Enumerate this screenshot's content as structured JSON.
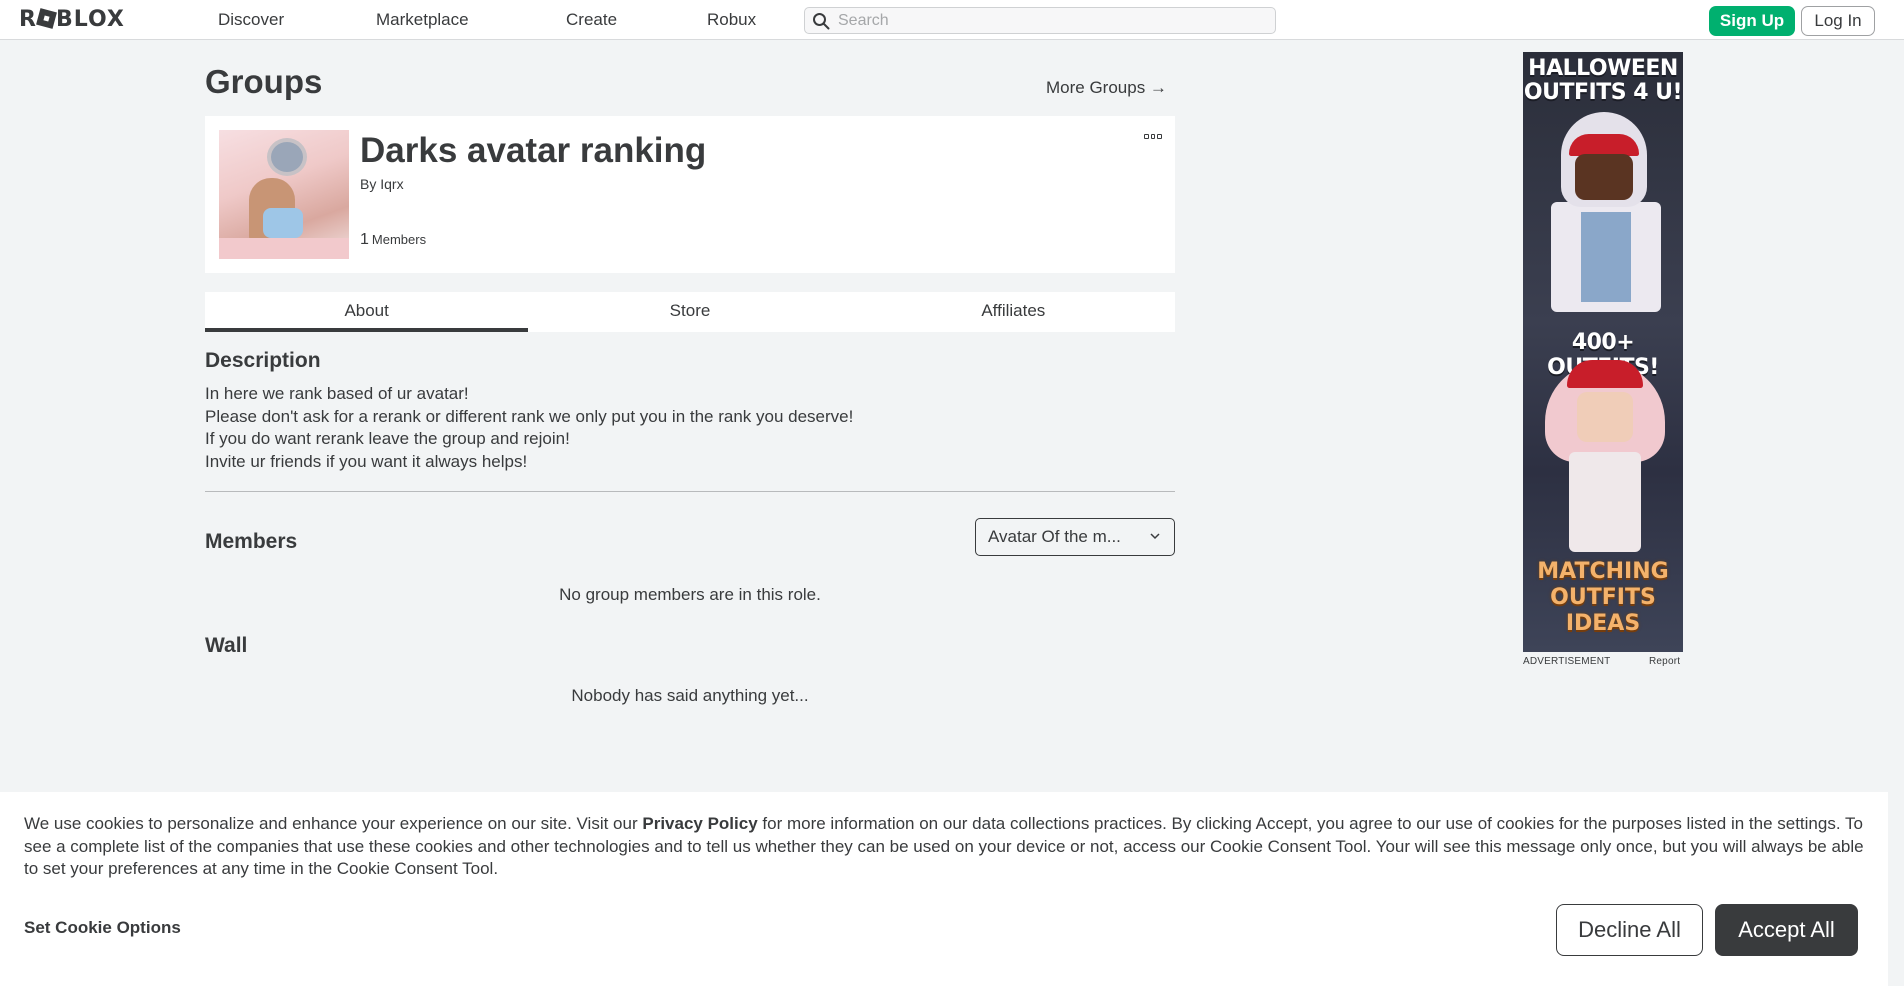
{
  "nav": {
    "logo": "ROBLOX",
    "links": [
      "Discover",
      "Marketplace",
      "Create",
      "Robux"
    ],
    "search_placeholder": "Search",
    "signup_label": "Sign Up",
    "login_label": "Log In"
  },
  "page": {
    "title": "Groups",
    "more_groups": "More Groups →"
  },
  "group": {
    "name": "Darks avatar ranking",
    "by_prefix": "By",
    "owner": "Iqrx",
    "member_count": "1",
    "member_label": "Members"
  },
  "tabs": [
    {
      "label": "About",
      "active": true
    },
    {
      "label": "Store",
      "active": false
    },
    {
      "label": "Affiliates",
      "active": false
    }
  ],
  "about": {
    "description_title": "Description",
    "description_lines": [
      "In here we rank based of ur avatar!",
      "Please don't ask for a rerank or different rank we only put you in the rank you deserve!",
      "If you do want rerank leave the group and rejoin!",
      "Invite ur friends if you want it always helps!"
    ],
    "members_title": "Members",
    "role_selected": "Avatar Of the m...",
    "members_empty": "No group members are in this role.",
    "wall_title": "Wall",
    "wall_empty": "Nobody has said anything yet..."
  },
  "ad": {
    "headline_1": "HALLOWEEN",
    "headline_2": "OUTFITS 4 U!",
    "middle": "400+ OUTFITS!",
    "logo_1": "MATCHING",
    "logo_2": "OUTFITS",
    "logo_3": "IDEAS",
    "label": "ADVERTISEMENT",
    "report": "Report"
  },
  "cookie": {
    "text_before": "We use cookies to personalize and enhance your experience on our site. Visit our ",
    "privacy_link": "Privacy Policy",
    "text_after": " for more information on our data collections practices. By clicking Accept, you agree to our use of cookies for the purposes listed in the settings. To see a complete list of the companies that use these cookies and other technologies and to tell us whether they can be used on your device or not, access our Cookie Consent Tool. Your will see this message only once, but you will always be able to set your preferences at any time in the Cookie Consent Tool.",
    "options_label": "Set Cookie Options",
    "decline_label": "Decline All",
    "accept_label": "Accept All"
  },
  "colors": {
    "signup_green": "#00b06f",
    "text_dark": "#393b3d",
    "page_bg": "#f2f4f5"
  }
}
